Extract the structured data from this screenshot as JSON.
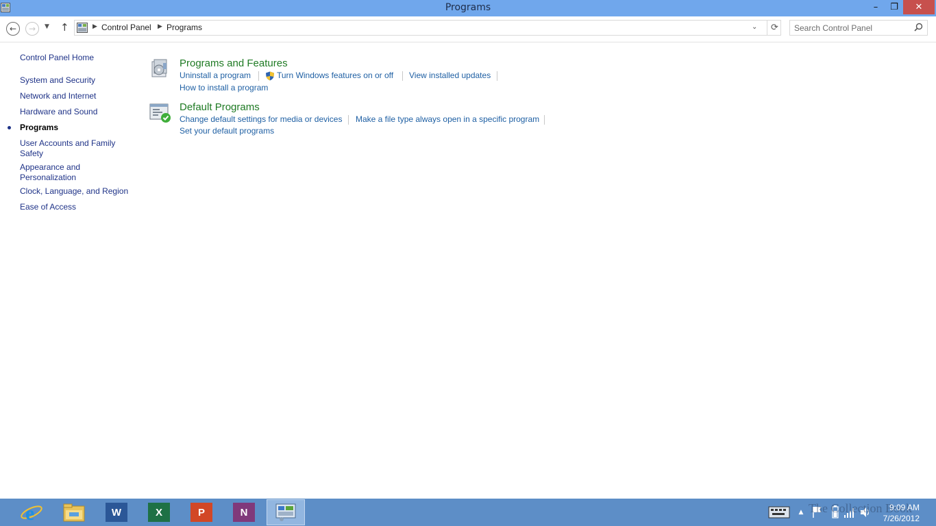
{
  "window": {
    "title": "Programs",
    "minimize_glyph": "–",
    "restore_glyph": "❐",
    "close_glyph": "✕"
  },
  "address_bar": {
    "back_glyph": "←",
    "forward_glyph": "→",
    "recent_glyph": "▼",
    "up_glyph": "↑",
    "breadcrumbs": [
      "Control Panel",
      "Programs"
    ],
    "crumb_separator": "▶",
    "dropdown_glyph": "⌄",
    "refresh_glyph": "⟳",
    "search_placeholder": "Search Control Panel"
  },
  "sidebar": {
    "items": [
      {
        "label": "Control Panel Home"
      },
      {
        "label": "System and Security"
      },
      {
        "label": "Network and Internet"
      },
      {
        "label": "Hardware and Sound"
      },
      {
        "label": "Programs",
        "current": true
      },
      {
        "label": "User Accounts and Family Safety"
      },
      {
        "label": "Appearance and Personalization"
      },
      {
        "label": "Clock, Language, and Region"
      },
      {
        "label": "Ease of Access"
      }
    ]
  },
  "sections": [
    {
      "title": "Programs and Features",
      "icon": "programs-features-icon",
      "tasks": [
        "Uninstall a program",
        "Turn Windows features on or off",
        "View installed updates",
        "How to install a program"
      ]
    },
    {
      "title": "Default Programs",
      "icon": "default-programs-icon",
      "tasks": [
        "Change default settings for media or devices",
        "Make a file type always open in a specific program",
        "Set your default programs"
      ]
    }
  ],
  "taskbar": {
    "apps": [
      {
        "name": "Internet Explorer",
        "icon": "ie-icon",
        "glyph": "e"
      },
      {
        "name": "File Explorer",
        "icon": "file-explorer-icon",
        "glyph": ""
      },
      {
        "name": "Word",
        "icon": "word-icon",
        "glyph": "W",
        "color": "#2b5797"
      },
      {
        "name": "Excel",
        "icon": "excel-icon",
        "glyph": "X",
        "color": "#1e7145"
      },
      {
        "name": "PowerPoint",
        "icon": "powerpoint-icon",
        "glyph": "P",
        "color": "#d24726"
      },
      {
        "name": "OneNote",
        "icon": "onenote-icon",
        "glyph": "N",
        "color": "#80397b"
      },
      {
        "name": "Control Panel",
        "icon": "control-panel-icon",
        "glyph": "",
        "active": true
      }
    ],
    "tray": {
      "show_hidden_glyph": "▲",
      "time": "9:09 AM",
      "date": "7/26/2012"
    },
    "watermark": "The Collection Book"
  },
  "colors": {
    "titlebar": "#70a7ec",
    "close_button": "#c7504d",
    "section_title": "#1e7a23",
    "task_link": "#1e5fa3",
    "taskbar": "#5d8ec7"
  }
}
